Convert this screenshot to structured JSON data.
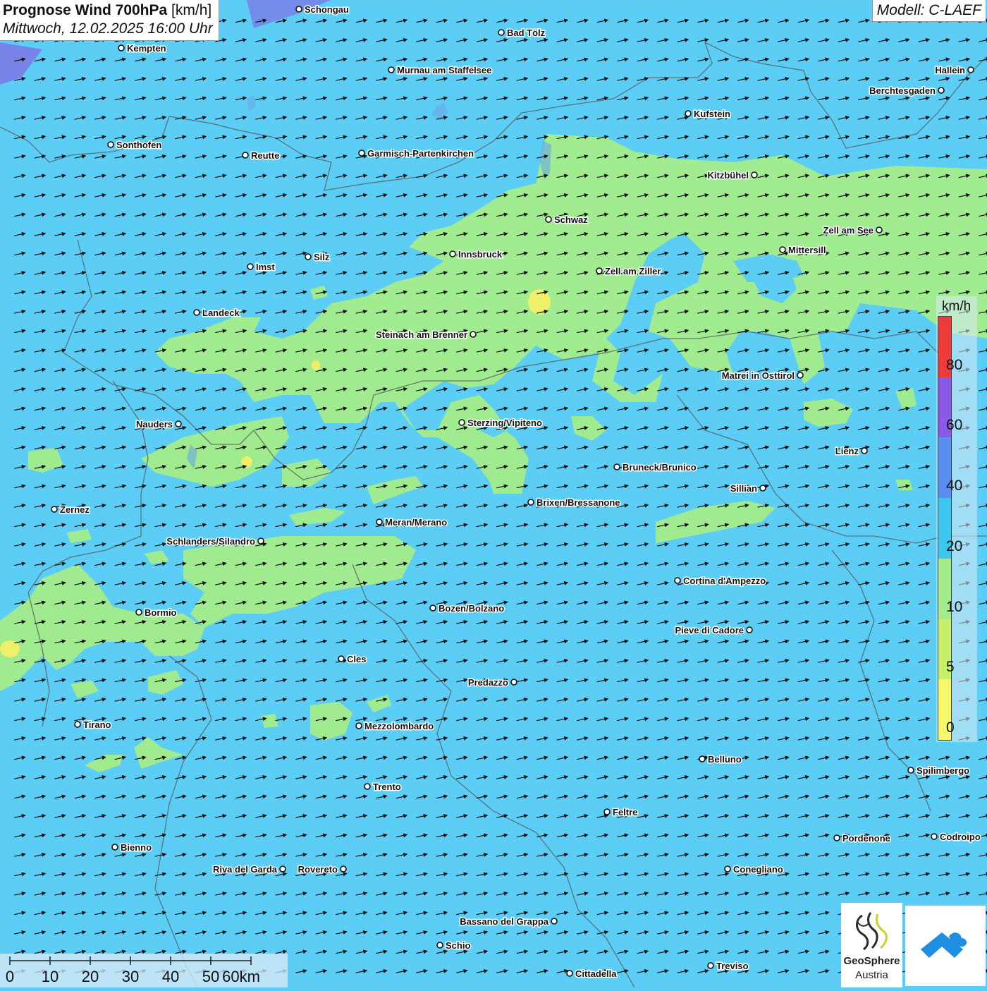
{
  "title": {
    "main": "Prognose Wind 700hPa",
    "unit": "[km/h]",
    "datetime": "Mittwoch, 12.02.2025 16:00 Uhr"
  },
  "model_label": "Modell: C-LAEF",
  "colors": {
    "calm_blue": "#5ccdf5",
    "wind_green": "#a4ec8a",
    "wind_yellow": "#eef06a",
    "upper_purple": "#7b7ce6",
    "arrow": "#111111"
  },
  "wind_direction_deg_from_east_upward": 12,
  "legend": {
    "unit": "km/h",
    "levels": [
      {
        "label": "0",
        "color": "#f7f76a"
      },
      {
        "label": "5",
        "color": "#c7f06a"
      },
      {
        "label": "10",
        "color": "#a4ec8a"
      },
      {
        "label": "20",
        "color": "#3cc7f0"
      },
      {
        "label": "40",
        "color": "#5a8ef0"
      },
      {
        "label": "60",
        "color": "#8a5ae6"
      },
      {
        "label": "80",
        "color": "#f03a3a"
      }
    ]
  },
  "scale_bar": {
    "labels": [
      "0",
      "10",
      "20",
      "30",
      "40",
      "50",
      "60km"
    ]
  },
  "cities": [
    {
      "name": "Schongau"
    },
    {
      "name": "Bad Tölz"
    },
    {
      "name": "Kempten"
    },
    {
      "name": "Murnau am Staffelsee"
    },
    {
      "name": "Hallein"
    },
    {
      "name": "Berchtesgaden"
    },
    {
      "name": "Kufstein"
    },
    {
      "name": "Sonthofen"
    },
    {
      "name": "Reutte"
    },
    {
      "name": "Garmisch-Partenkirchen"
    },
    {
      "name": "Kitzbühel"
    },
    {
      "name": "Schwaz"
    },
    {
      "name": "Zell am See"
    },
    {
      "name": "Innsbruck"
    },
    {
      "name": "Mittersill"
    },
    {
      "name": "Silz"
    },
    {
      "name": "Imst"
    },
    {
      "name": "Zell am Ziller"
    },
    {
      "name": "Landeck"
    },
    {
      "name": "Steinach am Brenner"
    },
    {
      "name": "Matrei in Osttirol"
    },
    {
      "name": "Nauders"
    },
    {
      "name": "Sterzing/Vipiteno"
    },
    {
      "name": "Lienz"
    },
    {
      "name": "Bruneck/Brunico"
    },
    {
      "name": "Sillian"
    },
    {
      "name": "Zernez"
    },
    {
      "name": "Brixen/Bressanone"
    },
    {
      "name": "Meran/Merano"
    },
    {
      "name": "Schlanders/Silandro"
    },
    {
      "name": "Cortina d'Ampezzo"
    },
    {
      "name": "Bozen/Bolzano"
    },
    {
      "name": "Bormio"
    },
    {
      "name": "Pieve di Cadore"
    },
    {
      "name": "Cles"
    },
    {
      "name": "Predazzo"
    },
    {
      "name": "Tirano"
    },
    {
      "name": "Mezzolombardo"
    },
    {
      "name": "Belluno"
    },
    {
      "name": "Spilimbergo"
    },
    {
      "name": "Trento"
    },
    {
      "name": "Feltre"
    },
    {
      "name": "Bienno"
    },
    {
      "name": "Pordenone"
    },
    {
      "name": "Codroipo"
    },
    {
      "name": "Riva del Garda"
    },
    {
      "name": "Rovereto"
    },
    {
      "name": "Conegliano"
    },
    {
      "name": "Bassano del Grappa"
    },
    {
      "name": "Schio"
    },
    {
      "name": "Treviso"
    },
    {
      "name": "Cittadella"
    }
  ],
  "logos": {
    "geosphere_line1": "GeoSphere",
    "geosphere_line2": "Austria"
  }
}
